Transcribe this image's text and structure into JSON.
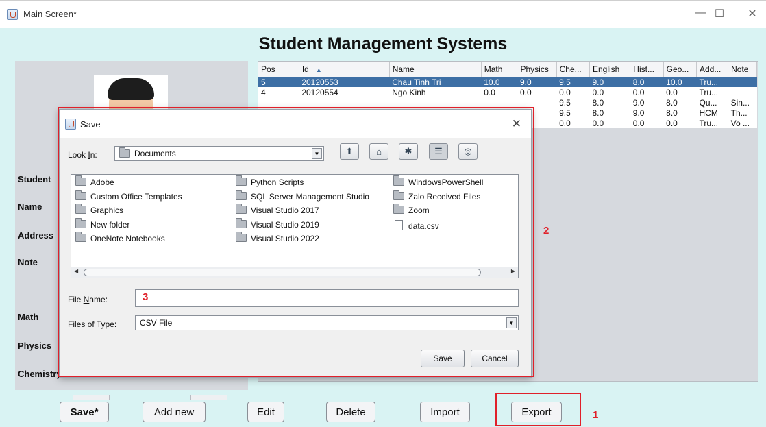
{
  "window": {
    "title": "Main Screen*",
    "minimize": "—",
    "maximize": "☐",
    "close": "✕"
  },
  "app": {
    "heading": "Student Management Systems"
  },
  "form_labels": {
    "student": "Student",
    "name": "Name",
    "address": "Address",
    "note": "Note",
    "math": "Math",
    "physics": "Physics",
    "chemistry": "Chemistry"
  },
  "table": {
    "columns": [
      "Pos",
      "Id",
      "Name",
      "Math",
      "Physics",
      "Che...",
      "English",
      "Hist...",
      "Geo...",
      "Add...",
      "Note"
    ],
    "sort_column": "Id",
    "selected_row": 0,
    "rows": [
      [
        "5",
        "20120553",
        "Chau Tinh Tri",
        "10.0",
        "9.0",
        "9.5",
        "9.0",
        "8.0",
        "10.0",
        "Tru...",
        ""
      ],
      [
        "4",
        "20120554",
        "Ngo Kinh",
        "0.0",
        "0.0",
        "0.0",
        "0.0",
        "0.0",
        "0.0",
        "Tru...",
        ""
      ],
      [
        "",
        "",
        "",
        "",
        "",
        "9.5",
        "8.0",
        "9.0",
        "8.0",
        "Qu...",
        "Sin..."
      ],
      [
        "",
        "",
        "",
        "",
        "",
        "9.5",
        "8.0",
        "9.0",
        "8.0",
        "HCM",
        "Th..."
      ],
      [
        "",
        "",
        "",
        "",
        "",
        "0.0",
        "0.0",
        "0.0",
        "0.0",
        "Tru...",
        "Vo ..."
      ]
    ]
  },
  "buttons": {
    "save": "Save*",
    "add_new": "Add new",
    "edit": "Edit",
    "delete": "Delete",
    "import": "Import",
    "export": "Export"
  },
  "dialog": {
    "title": "Save",
    "look_in_label_pre": "Look ",
    "look_in_label_u": "I",
    "look_in_label_post": "n:",
    "look_in_value": "Documents",
    "file_name_label_pre": "File ",
    "file_name_label_u": "N",
    "file_name_label_post": "ame:",
    "file_name_value": "",
    "files_of_type_label_pre": "Files of ",
    "files_of_type_label_u": "T",
    "files_of_type_label_post": "ype:",
    "files_of_type_value": "CSV File",
    "save_button": "Save",
    "cancel_button": "Cancel",
    "files": [
      {
        "name": "Adobe",
        "type": "folder"
      },
      {
        "name": "Custom Office Templates",
        "type": "folder"
      },
      {
        "name": "Graphics",
        "type": "folder"
      },
      {
        "name": "New folder",
        "type": "folder"
      },
      {
        "name": "OneNote Notebooks",
        "type": "folder"
      },
      {
        "name": "Python Scripts",
        "type": "folder"
      },
      {
        "name": "SQL Server Management Studio",
        "type": "folder"
      },
      {
        "name": "Visual Studio 2017",
        "type": "folder"
      },
      {
        "name": "Visual Studio 2019",
        "type": "folder"
      },
      {
        "name": "Visual Studio 2022",
        "type": "folder"
      },
      {
        "name": "WindowsPowerShell",
        "type": "folder"
      },
      {
        "name": "Zalo Received Files",
        "type": "folder"
      },
      {
        "name": "Zoom",
        "type": "folder"
      },
      {
        "name": "data.csv",
        "type": "file"
      }
    ]
  },
  "annotations": {
    "one": "1",
    "two": "2",
    "three": "3",
    "color": "#e0202a"
  }
}
